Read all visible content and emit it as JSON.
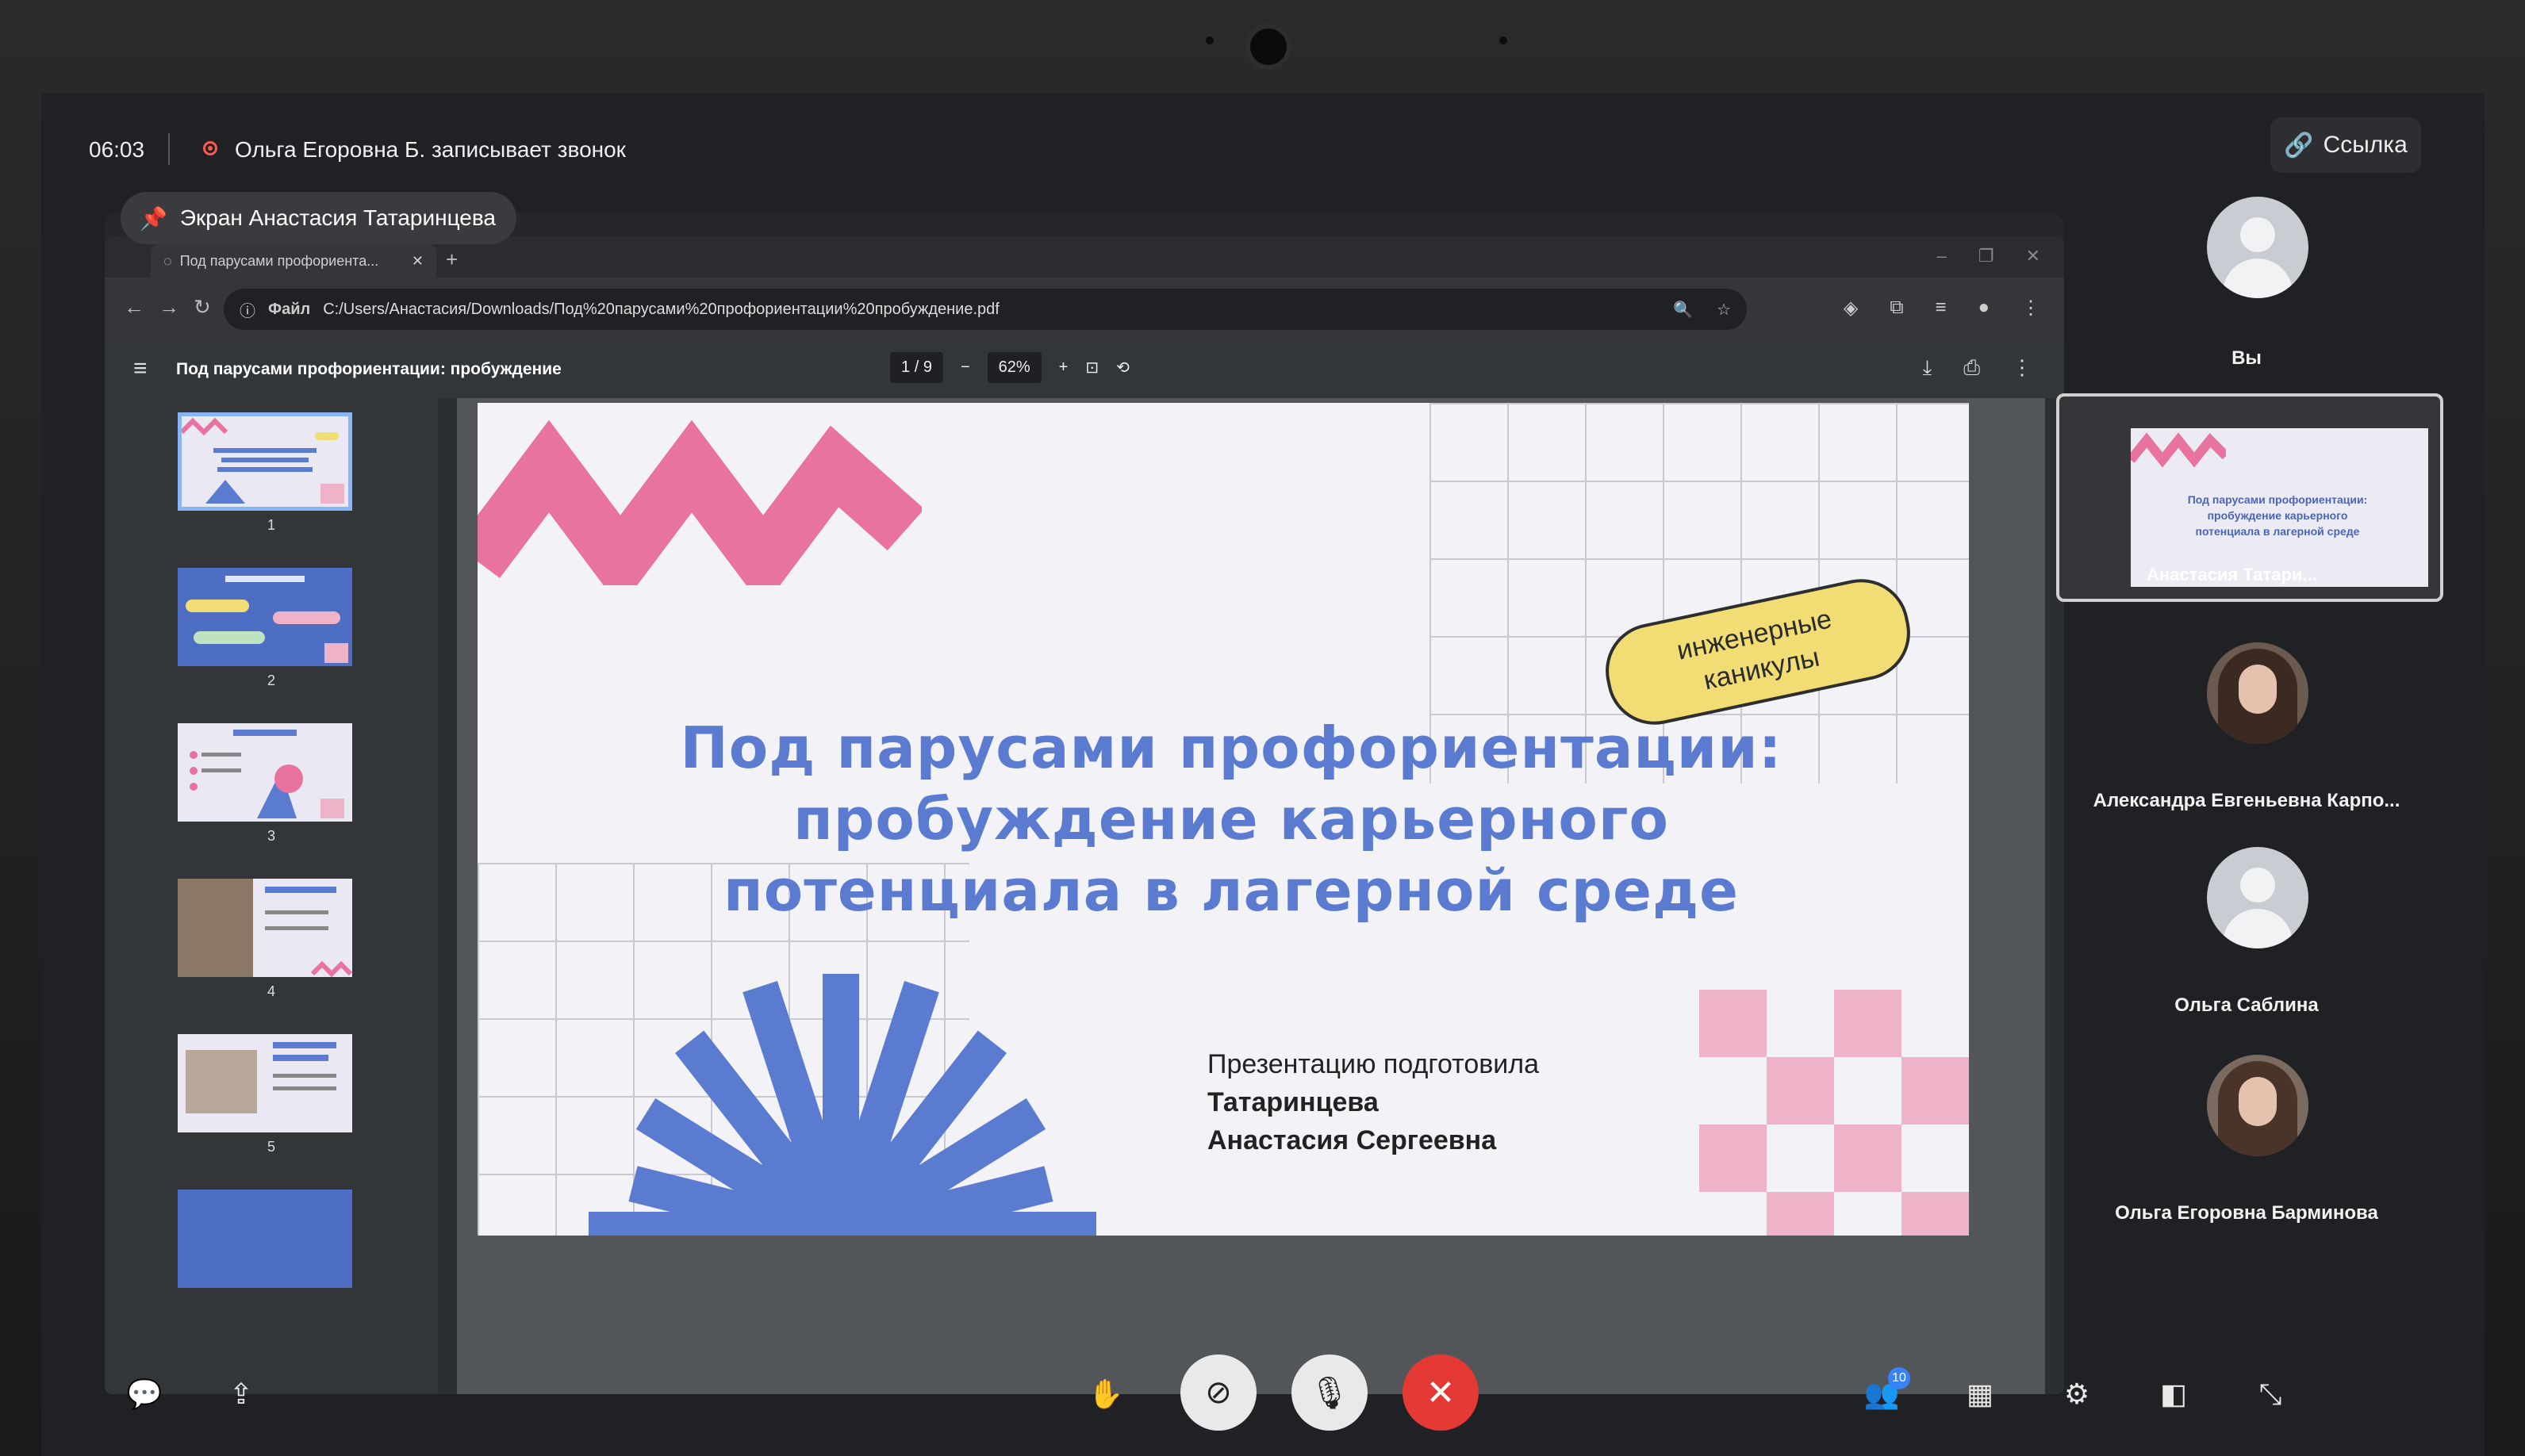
{
  "call": {
    "timer": "06:03",
    "recording_text": "Ольга Егоровна Б. записывает звонок",
    "link_label": "Ссылка",
    "share_label": "Экран Анастасия Татаринцева"
  },
  "browser": {
    "tab_title": "Под парусами профориента...",
    "url_prefix": "Файл",
    "url": "C:/Users/Анастасия/Downloads/Под%20парусами%20профориентации%20пробуждение.pdf"
  },
  "pdf": {
    "title": "Под парусами профориентации: пробуждение",
    "page_current": "1",
    "page_sep": "/",
    "page_total": "9",
    "zoom": "62%",
    "thumbnails": [
      {
        "num": "1"
      },
      {
        "num": "2"
      },
      {
        "num": "3"
      },
      {
        "num": "4"
      },
      {
        "num": "5"
      }
    ]
  },
  "slide": {
    "badge_line1": "инженерные",
    "badge_line2": "каникулы",
    "title_line1": "Под парусами профориентации:",
    "title_line2": "пробуждение карьерного",
    "title_line3": "потенциала в лагерной среде",
    "author_intro": "Презентацию подготовила",
    "author_surname": "Татаринцева",
    "author_name": "Анастасия Сергеевна"
  },
  "participants": [
    {
      "name": "Вы"
    },
    {
      "name": "Анастасия Татари..."
    },
    {
      "name": "Александра Евгеньевна Карпо..."
    },
    {
      "name": "Ольга Саблина"
    },
    {
      "name": "Ольга Егоровна Барминова"
    }
  ],
  "controls": {
    "participants_count": "10"
  },
  "colors": {
    "slide_blue": "#5b7bd0",
    "slide_pink": "#e8739f",
    "badge_yellow": "#f1dd73",
    "end_call_red": "#e53935",
    "recording_red": "#ff5a4e"
  }
}
